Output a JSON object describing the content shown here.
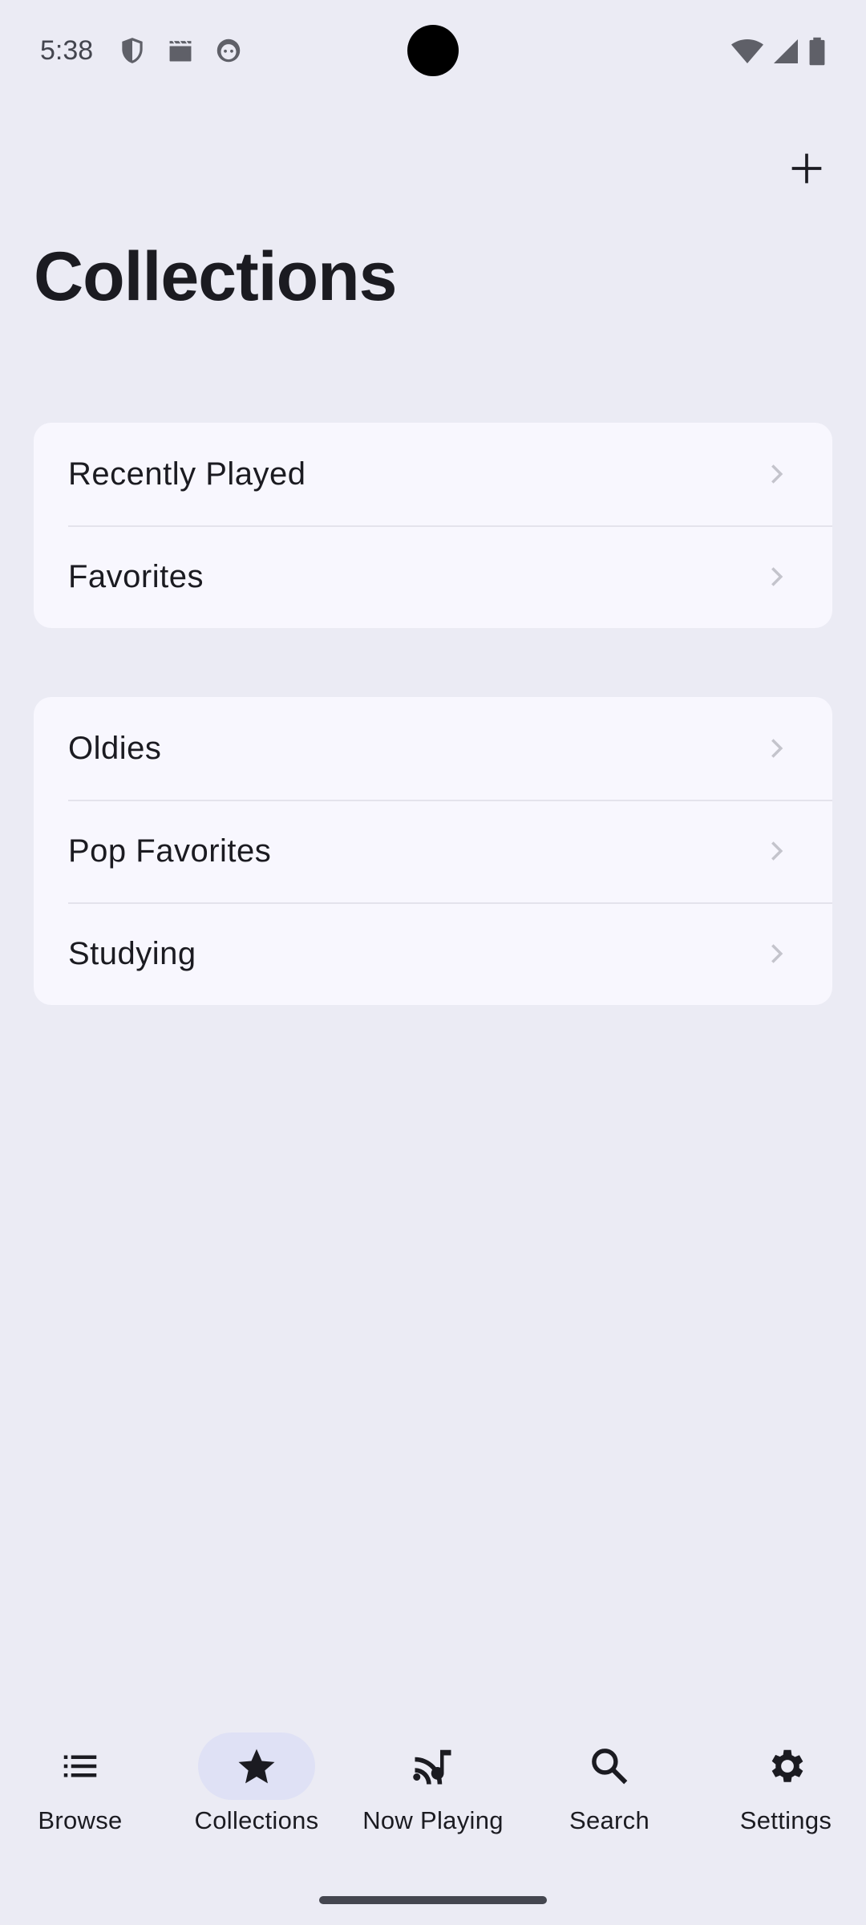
{
  "status_bar": {
    "time": "5:38",
    "left_icons": [
      "shield-icon",
      "clapperboard-icon",
      "face-icon"
    ],
    "right_icons": [
      "wifi-icon",
      "signal-icon",
      "battery-icon"
    ]
  },
  "header": {
    "title": "Collections",
    "add_icon": "plus-icon"
  },
  "lists": {
    "system": [
      {
        "label": "Recently Played"
      },
      {
        "label": "Favorites"
      }
    ],
    "user": [
      {
        "label": "Oldies"
      },
      {
        "label": "Pop Favorites"
      },
      {
        "label": "Studying"
      }
    ]
  },
  "bottom_nav": {
    "items": [
      {
        "label": "Browse",
        "icon": "list-icon",
        "active": false
      },
      {
        "label": "Collections",
        "icon": "star-icon",
        "active": true
      },
      {
        "label": "Now Playing",
        "icon": "podcast-note-icon",
        "active": false
      },
      {
        "label": "Search",
        "icon": "search-icon",
        "active": false
      },
      {
        "label": "Settings",
        "icon": "gear-icon",
        "active": false
      }
    ]
  },
  "colors": {
    "background": "#ebebf4",
    "card": "#f8f7fe",
    "active_indicator": "#dfe1f5",
    "text": "#1b1b21",
    "chevron": "#c4c4cc"
  }
}
